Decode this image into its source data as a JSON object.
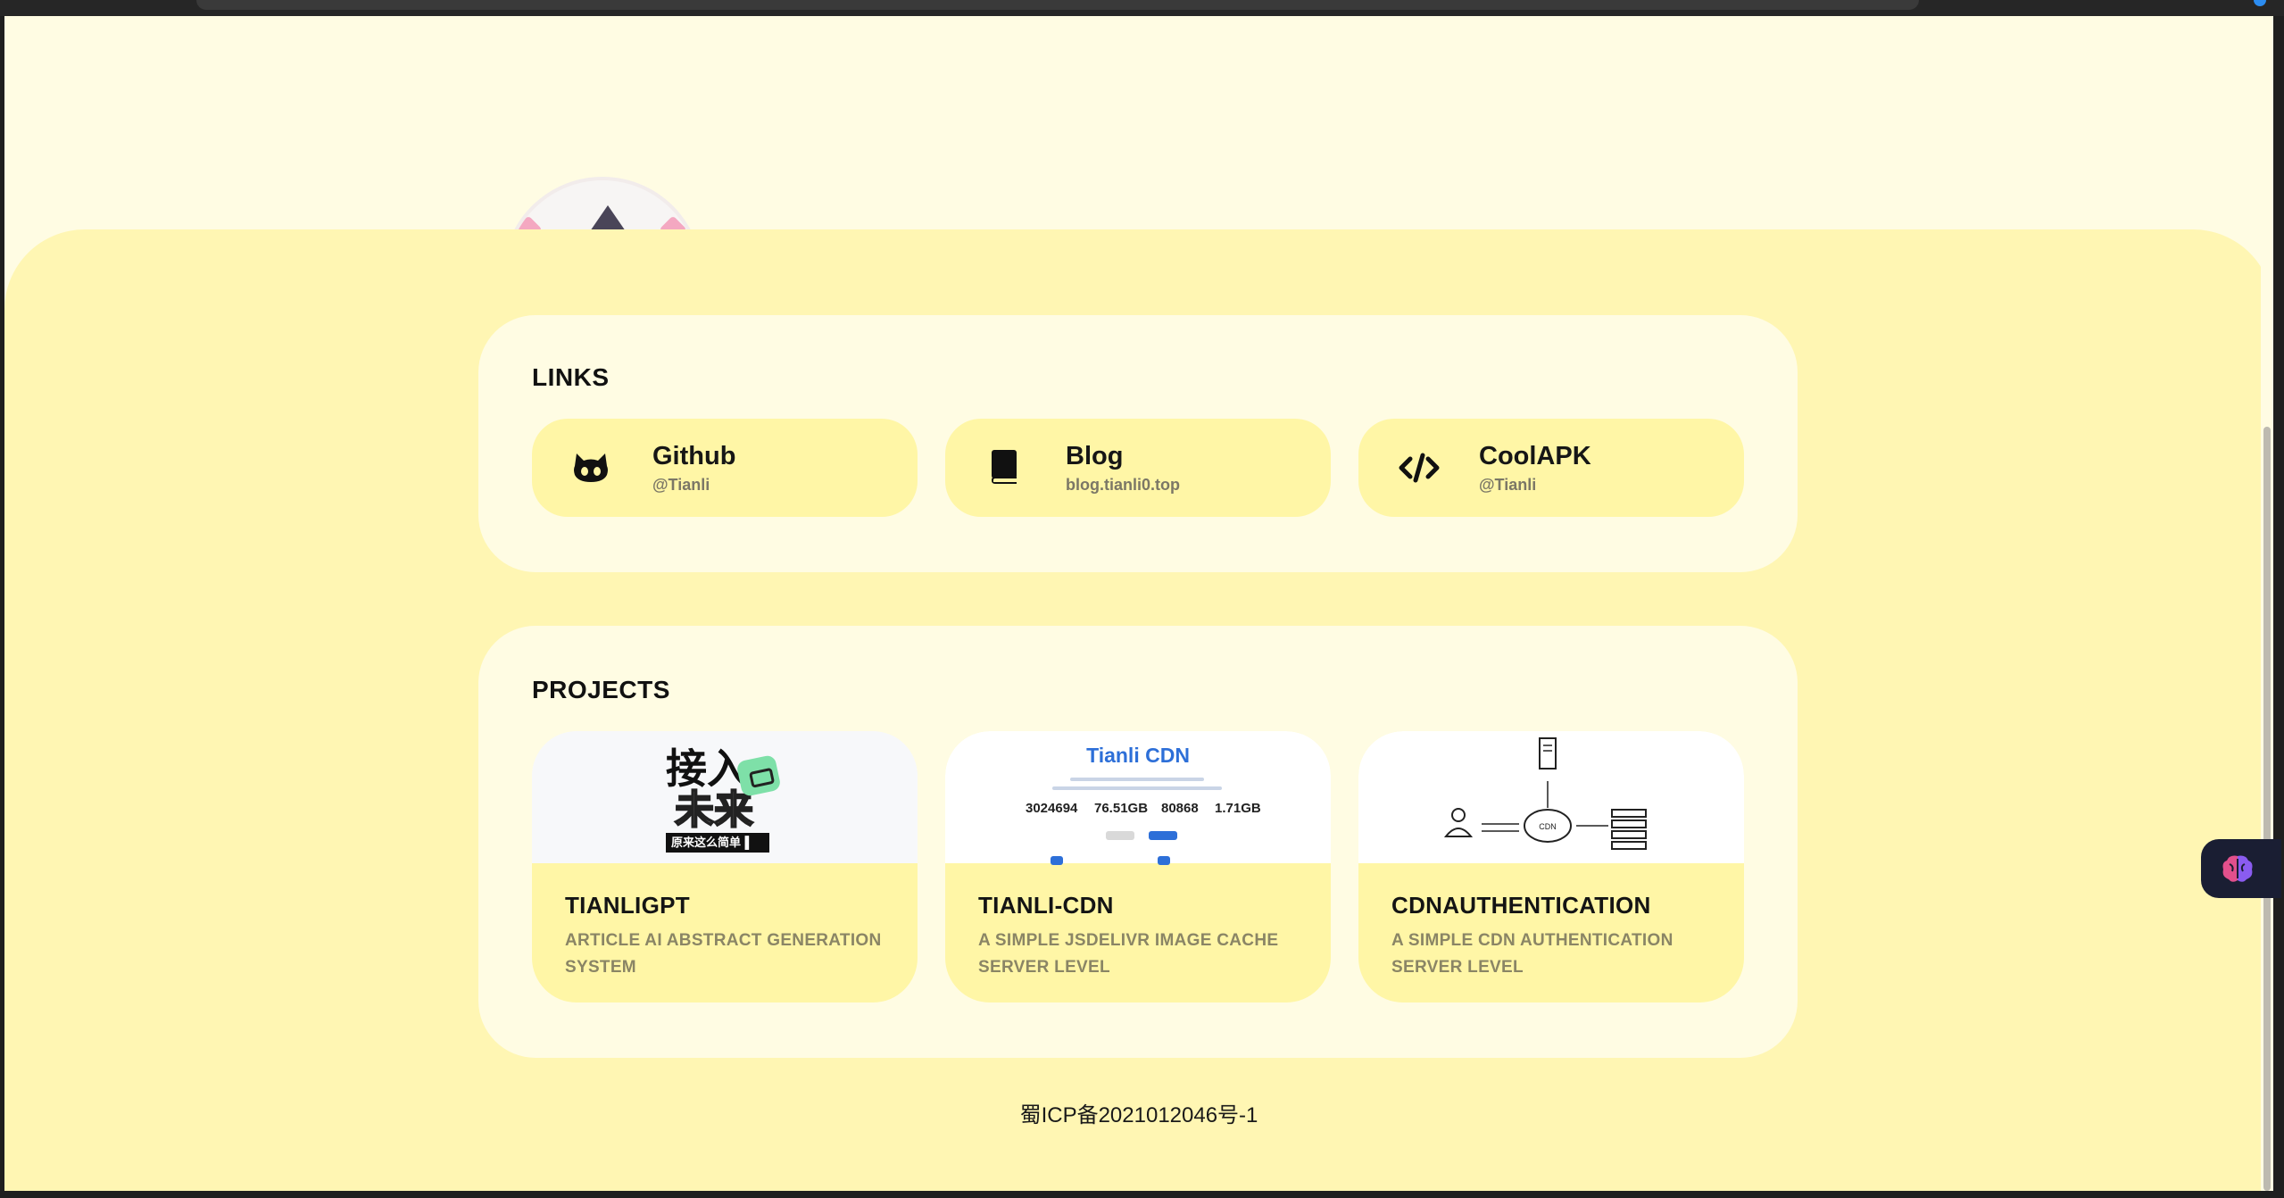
{
  "links": {
    "heading": "LINKS",
    "items": [
      {
        "title": "Github",
        "sub": "@Tianli",
        "icon": "github-icon"
      },
      {
        "title": "Blog",
        "sub": "blog.tianli0.top",
        "icon": "book-icon"
      },
      {
        "title": "CoolAPK",
        "sub": "@Tianli",
        "icon": "code-icon"
      }
    ]
  },
  "projects": {
    "heading": "PROJECTS",
    "items": [
      {
        "name": "TIANLIGPT",
        "desc": "ARTICLE AI ABSTRACT GENERATION SYSTEM",
        "thumb": {
          "line1": "接入",
          "line2": "未来",
          "tag": "原来这么简单▐"
        }
      },
      {
        "name": "TIANLI-CDN",
        "desc": "A SIMPLE JSDELIVR IMAGE CACHE SERVER LEVEL",
        "thumb": {
          "title": "Tianli CDN",
          "stats": [
            "3024694",
            "76.51GB",
            "80868",
            "1.71GB"
          ]
        }
      },
      {
        "name": "CDNAUTHENTICATION",
        "desc": "A SIMPLE CDN AUTHENTICATION SERVER LEVEL",
        "thumb": {
          "cloud": "CDN"
        }
      }
    ]
  },
  "footer": {
    "icp": "蜀ICP备2021012046号-1"
  },
  "colors": {
    "page_bg": "#fffce3",
    "sheet_bg": "#fff6b3",
    "card_bg": "#fff6a6",
    "accent_blue": "#2d6fd8"
  }
}
